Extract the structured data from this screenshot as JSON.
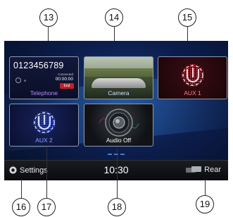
{
  "callouts": {
    "n13": "13",
    "n14": "14",
    "n15": "15",
    "n16": "16",
    "n17": "17",
    "n18": "18",
    "n19": "19"
  },
  "tiles": {
    "telephone": {
      "number": "0123456789",
      "status": "Connected",
      "timer": "00:00:00",
      "end_label": "End",
      "label": "Telephone"
    },
    "camera": {
      "label": "Camera"
    },
    "aux1": {
      "label": "AUX 1"
    },
    "aux2": {
      "label": "AUX 2"
    },
    "audio": {
      "label": "Audio Off"
    }
  },
  "bottombar": {
    "settings_label": "Settings",
    "clock": "10:30",
    "rear_label": "Rear"
  },
  "icons": [
    "gear-icon",
    "aux-input-icon",
    "speaker-icon",
    "rear-display-icon"
  ],
  "colors": {
    "screen_bg": "#0c1e4d",
    "telephone_label": "#b38cff",
    "aux1_accent": "#c0202a",
    "aux2_accent": "#2040c0"
  }
}
